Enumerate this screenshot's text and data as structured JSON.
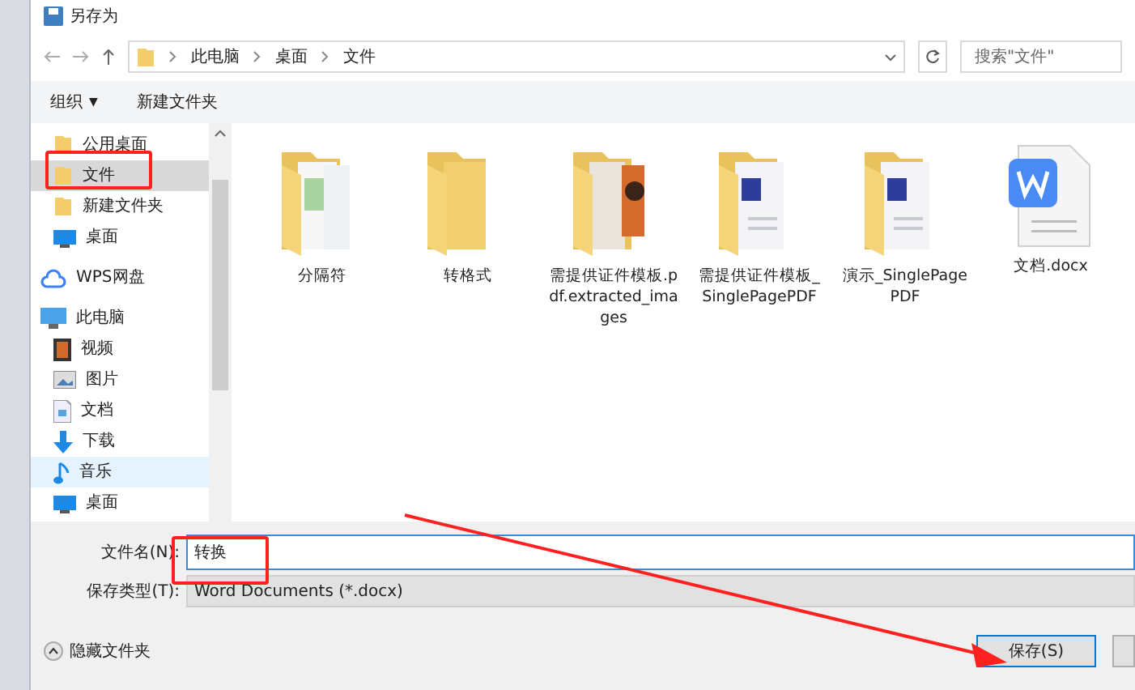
{
  "window": {
    "title": "另存为"
  },
  "address": {
    "path": [
      "此电脑",
      "桌面",
      "文件"
    ],
    "search_placeholder": "搜索\"文件\""
  },
  "toolbar": {
    "organize": "组织",
    "organize_caret": "▼",
    "new_folder": "新建文件夹"
  },
  "sidebar": {
    "pinned": [
      {
        "label": "公用桌面",
        "kind": "folder",
        "selected": false
      },
      {
        "label": "文件",
        "kind": "folder",
        "selected": true
      },
      {
        "label": "新建文件夹",
        "kind": "folder",
        "selected": false
      },
      {
        "label": "桌面",
        "kind": "desktop",
        "selected": false
      }
    ],
    "items": [
      {
        "label": "WPS网盘",
        "kind": "cloud",
        "selected": false
      },
      {
        "label": "此电脑",
        "kind": "pc",
        "selected": false,
        "children": [
          {
            "label": "视频",
            "kind": "video",
            "selected": false
          },
          {
            "label": "图片",
            "kind": "picture",
            "selected": false
          },
          {
            "label": "文档",
            "kind": "document",
            "selected": false
          },
          {
            "label": "下载",
            "kind": "download",
            "selected": false
          },
          {
            "label": "音乐",
            "kind": "music",
            "selected": true
          },
          {
            "label": "桌面",
            "kind": "desktop",
            "selected": false
          }
        ]
      }
    ]
  },
  "files": [
    {
      "name": "分隔符",
      "kind": "folder-green"
    },
    {
      "name": "转格式",
      "kind": "folder"
    },
    {
      "name": "需提供证件模板.pdf.extracted_images",
      "kind": "folder-photo"
    },
    {
      "name": "需提供证件模板_SinglePagePDF",
      "kind": "folder-doc"
    },
    {
      "name": "演示_SinglePagePDF",
      "kind": "folder-doc"
    },
    {
      "name": "文档.docx",
      "kind": "word"
    }
  ],
  "form": {
    "filename_label": "文件名(N):",
    "filename_value": "转换",
    "type_label": "保存类型(T):",
    "type_value": "Word Documents (*.docx)"
  },
  "footer": {
    "hide_folders": "隐藏文件夹",
    "save_button": "保存(S)"
  }
}
